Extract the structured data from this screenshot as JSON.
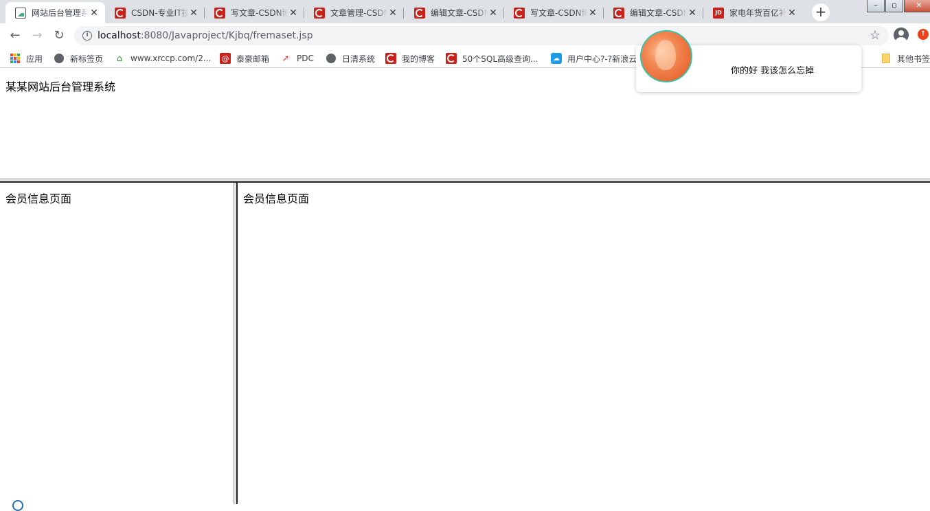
{
  "browser": {
    "tabs": [
      {
        "title": "网站后台管理系",
        "favicon": "page-icon",
        "active": true
      },
      {
        "title": "CSDN-专业IT技",
        "favicon": "csdn-icon",
        "active": false
      },
      {
        "title": "写文章-CSDN博",
        "favicon": "csdn-icon",
        "active": false
      },
      {
        "title": "文章管理-CSDN",
        "favicon": "csdn-icon",
        "active": false
      },
      {
        "title": "编辑文章-CSDN",
        "favicon": "csdn-icon",
        "active": false
      },
      {
        "title": "写文章-CSDN博",
        "favicon": "csdn-icon",
        "active": false
      },
      {
        "title": "编辑文章-CSDN",
        "favicon": "csdn-icon",
        "active": false
      },
      {
        "title": "家电年货百亿补",
        "favicon": "jd-icon",
        "active": false
      }
    ],
    "tab_close_glyph": "✕",
    "new_tab_glyph": "+",
    "window_controls": {
      "minimize": "–",
      "maximize": "▫",
      "close": "✕"
    },
    "nav": {
      "back": "←",
      "forward": "→",
      "reload": "↻"
    },
    "address": {
      "host": "localhost",
      "rest": ":8080/Javaproject/Kjbq/fremaset.jsp",
      "info_glyph": "i"
    },
    "star_glyph": "☆",
    "extension_glyph": "↑",
    "bookmarks": [
      {
        "label": "应用",
        "icon": "apps-grid-icon"
      },
      {
        "label": "新标签页",
        "icon": "globe-icon"
      },
      {
        "label": "www.xrccp.com/2...",
        "icon": "site-icon"
      },
      {
        "label": "泰豪邮箱",
        "icon": "mail-icon"
      },
      {
        "label": "PDC",
        "icon": "rocket-icon"
      },
      {
        "label": "日清系统",
        "icon": "globe-icon"
      },
      {
        "label": "我的博客",
        "icon": "csdn-icon"
      },
      {
        "label": "50个SQL高级查询...",
        "icon": "csdn-icon"
      },
      {
        "label": "用户中心?-?新浪云",
        "icon": "cloud-icon"
      }
    ],
    "other_bookmarks": "其他书签"
  },
  "page": {
    "top_frame_title": "某某网站后台管理系统",
    "left_frame_text": "会员信息页面",
    "right_frame_text": "会员信息页面"
  },
  "popup": {
    "message": "你的好 我该怎么忘掉",
    "avatar": "avatar-portrait"
  },
  "colors": {
    "accent_red": "#c9221c",
    "tabstrip_bg": "#dee1e6",
    "popup_ring": "#3ec1a6"
  }
}
